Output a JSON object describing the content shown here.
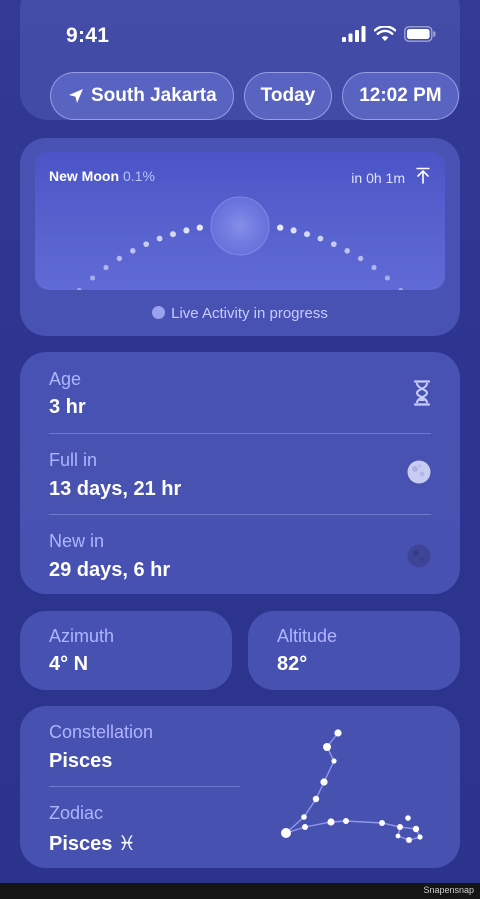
{
  "status_bar": {
    "time": "9:41"
  },
  "chips": {
    "location": "South Jakarta",
    "day": "Today",
    "clock": "12:02 PM"
  },
  "moon_card": {
    "phase_name": "New Moon",
    "phase_percent": "0.1%",
    "next_event": "in 0h 1m",
    "live_activity": "Live Activity in progress"
  },
  "info_rows": [
    {
      "label": "Age",
      "value": "3 hr",
      "icon": "hourglass-icon"
    },
    {
      "label": "Full in",
      "value": "13 days, 21 hr",
      "icon": "full-moon-icon"
    },
    {
      "label": "New in",
      "value": "29 days, 6 hr",
      "icon": "new-moon-icon"
    }
  ],
  "azimuth": {
    "label": "Azimuth",
    "value": "4° N"
  },
  "altitude": {
    "label": "Altitude",
    "value": "82°"
  },
  "constellation": {
    "label": "Constellation",
    "value": "Pisces",
    "zodiac_label": "Zodiac",
    "zodiac_value": "Pisces ♓︎"
  },
  "credit": "Snapensnap",
  "colors": {
    "background": "#2e3691",
    "card": "#5f69cd",
    "label": "#aeb5ff"
  }
}
